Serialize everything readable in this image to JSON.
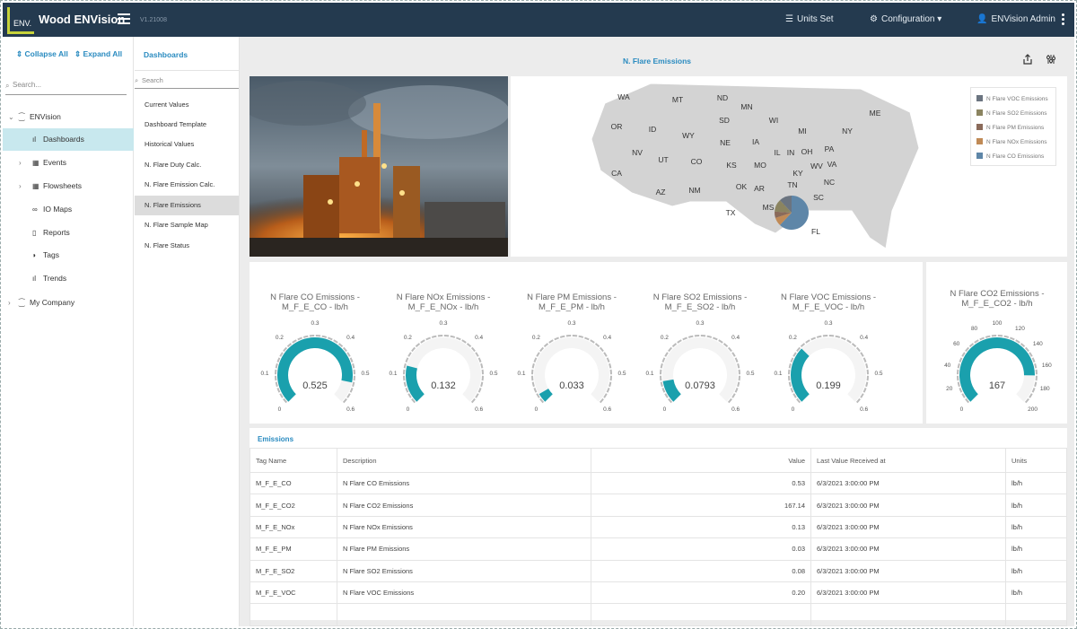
{
  "app": {
    "logo_text": "ENV.",
    "title": "Wood ENVision",
    "version": "V1.21008"
  },
  "topbar": {
    "units": "Units Set",
    "configuration": "Configuration",
    "user": "ENVision Admin"
  },
  "tree": {
    "collapse_all": "Collapse All",
    "expand_all": "Expand All",
    "search_placeholder": "Search...",
    "nodes": [
      "ENVision",
      "Dashboards",
      "Events",
      "Flowsheets",
      "IO Maps",
      "Reports",
      "Tags",
      "Trends",
      "My Company"
    ]
  },
  "dashboards": {
    "title": "Dashboards",
    "search_placeholder": "Search",
    "items": [
      "Current Values",
      "Dashboard Template",
      "Historical Values",
      "N. Flare Duty Calc.",
      "N. Flare Emission Calc.",
      "N. Flare Emissions",
      "N. Flare Sample Map",
      "N. Flare Status"
    ],
    "selected": "N. Flare Emissions"
  },
  "main": {
    "title": "N. Flare Emissions"
  },
  "map": {
    "states": [
      "WA",
      "MT",
      "ND",
      "MN",
      "OR",
      "ID",
      "SD",
      "WI",
      "MI",
      "ME",
      "WY",
      "IA",
      "NY",
      "NE",
      "NV",
      "UT",
      "CO",
      "IL",
      "IN",
      "OH",
      "PA",
      "CA",
      "KS",
      "MO",
      "KY",
      "WV",
      "VA",
      "OK",
      "AR",
      "TN",
      "NC",
      "AZ",
      "NM",
      "SC",
      "MS",
      "AL",
      "GA",
      "TX",
      "FL"
    ],
    "legend": [
      {
        "label": "N Flare VOC Emissions",
        "color": "#6b7480"
      },
      {
        "label": "N Flare SO2 Emissions",
        "color": "#8b8460"
      },
      {
        "label": "N Flare PM Emissions",
        "color": "#8a6a5a"
      },
      {
        "label": "N Flare NOx Emissions",
        "color": "#c08a56"
      },
      {
        "label": "N Flare CO Emissions",
        "color": "#5e86a8"
      }
    ]
  },
  "gauges": [
    {
      "title1": "N Flare CO Emissions -",
      "title2": "M_F_E_CO - lb/h",
      "value": "0.525",
      "fraction": 0.875,
      "ticks": [
        "0",
        "0.1",
        "0.2",
        "0.3",
        "0.4",
        "0.5",
        "0.6"
      ]
    },
    {
      "title1": "N Flare NOx Emissions -",
      "title2": "M_F_E_NOx - lb/h",
      "value": "0.132",
      "fraction": 0.22,
      "ticks": [
        "0",
        "0.1",
        "0.2",
        "0.3",
        "0.4",
        "0.5",
        "0.6"
      ]
    },
    {
      "title1": "N Flare PM Emissions -",
      "title2": "M_F_E_PM - lb/h",
      "value": "0.033",
      "fraction": 0.055,
      "ticks": [
        "0",
        "0.1",
        "0.2",
        "0.3",
        "0.4",
        "0.5",
        "0.6"
      ]
    },
    {
      "title1": "N Flare SO2 Emissions -",
      "title2": "M_F_E_SO2 - lb/h",
      "value": "0.0793",
      "fraction": 0.132,
      "ticks": [
        "0",
        "0.1",
        "0.2",
        "0.3",
        "0.4",
        "0.5",
        "0.6"
      ]
    },
    {
      "title1": "N Flare VOC Emissions -",
      "title2": "M_F_E_VOC - lb/h",
      "value": "0.199",
      "fraction": 0.332,
      "ticks": [
        "0",
        "0.1",
        "0.2",
        "0.3",
        "0.4",
        "0.5",
        "0.6"
      ]
    },
    {
      "title1": "N Flare CO2 Emissions -",
      "title2": "M_F_E_CO2 - lb/h",
      "value": "167",
      "fraction": 0.835,
      "ticks": [
        "0",
        "20",
        "40",
        "60",
        "80",
        "100",
        "120",
        "140",
        "160",
        "180",
        "200"
      ]
    }
  ],
  "table": {
    "title": "Emissions",
    "headers": [
      "Tag Name",
      "Description",
      "Value",
      "Last Value Received at",
      "Units"
    ],
    "rows": [
      [
        "M_F_E_CO",
        "N Flare CO Emissions",
        "0.53",
        "6/3/2021 3:00:00 PM",
        "lb/h"
      ],
      [
        "M_F_E_CO2",
        "N Flare CO2 Emissions",
        "167.14",
        "6/3/2021 3:00:00 PM",
        "lb/h"
      ],
      [
        "M_F_E_NOx",
        "N Flare NOx Emissions",
        "0.13",
        "6/3/2021 3:00:00 PM",
        "lb/h"
      ],
      [
        "M_F_E_PM",
        "N Flare PM Emissions",
        "0.03",
        "6/3/2021 3:00:00 PM",
        "lb/h"
      ],
      [
        "M_F_E_SO2",
        "N Flare SO2 Emissions",
        "0.08",
        "6/3/2021 3:00:00 PM",
        "lb/h"
      ],
      [
        "M_F_E_VOC",
        "N Flare VOC Emissions",
        "0.20",
        "6/3/2021 3:00:00 PM",
        "lb/h"
      ]
    ]
  },
  "colors": {
    "accent": "#1aa0ad",
    "nav": "#243a4f",
    "link": "#2a8bc0"
  }
}
